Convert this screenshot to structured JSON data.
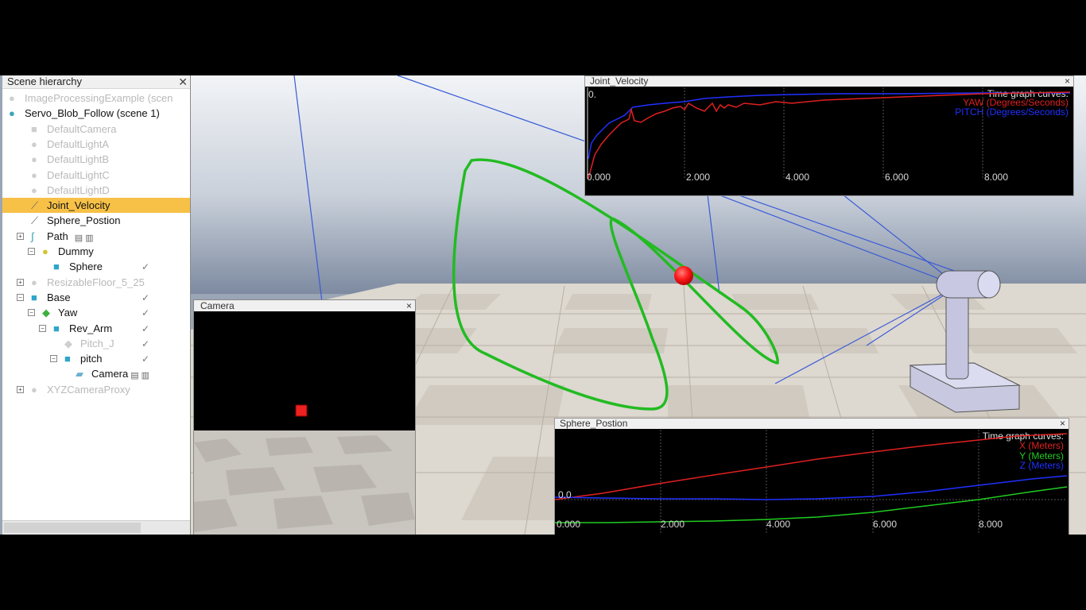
{
  "hierarchy": {
    "title": "Scene hierarchy",
    "close": "✕",
    "items": [
      {
        "label": "ImageProcessingExample (scen",
        "icon": "scene-sphere-icon",
        "dim": true
      },
      {
        "label": "Servo_Blob_Follow (scene 1)",
        "icon": "scene-sphere-icon",
        "dim": false
      },
      {
        "label": "DefaultCamera",
        "icon": "camera-icon",
        "dim": true
      },
      {
        "label": "DefaultLightA",
        "icon": "light-bulb-icon",
        "dim": true
      },
      {
        "label": "DefaultLightB",
        "icon": "light-bulb-icon",
        "dim": true
      },
      {
        "label": "DefaultLightC",
        "icon": "light-bulb-icon",
        "dim": true
      },
      {
        "label": "DefaultLightD",
        "icon": "light-bulb-icon",
        "dim": true
      },
      {
        "label": "Joint_Velocity",
        "icon": "graph-icon",
        "dim": false,
        "selected": true
      },
      {
        "label": "Sphere_Postion",
        "icon": "graph-icon",
        "dim": false
      },
      {
        "label": "Path",
        "icon": "path-icon",
        "dim": false
      },
      {
        "label": "Dummy",
        "icon": "dummy-icon",
        "dim": false
      },
      {
        "label": "Sphere",
        "icon": "shape-cube-icon",
        "dim": false
      },
      {
        "label": "ResizableFloor_5_25",
        "icon": "dummy-icon",
        "dim": true
      },
      {
        "label": "Base",
        "icon": "shape-cube-icon",
        "dim": false
      },
      {
        "label": "Yaw",
        "icon": "joint-icon",
        "dim": false
      },
      {
        "label": "Rev_Arm",
        "icon": "shape-cube-icon",
        "dim": false
      },
      {
        "label": "Pitch_J",
        "icon": "joint-icon",
        "dim": true
      },
      {
        "label": "pitch",
        "icon": "shape-cube-icon",
        "dim": false
      },
      {
        "label": "Camera",
        "icon": "vision-sensor-icon",
        "dim": false
      },
      {
        "label": "XYZCameraProxy",
        "icon": "dummy-icon",
        "dim": true
      }
    ]
  },
  "joint_velocity": {
    "title": "Joint_Velocity",
    "close": "×",
    "legend_title": "Time graph curves:",
    "legend": [
      "YAW (Degrees/Seconds)",
      "PITCH (Degrees/Seconds)"
    ],
    "x_ticks": [
      "0.000",
      "2.000",
      "4.000",
      "6.000",
      "8.000"
    ],
    "y_top_label": "0."
  },
  "sphere_position": {
    "title": "Sphere_Postion",
    "close": "×",
    "legend_title": "Time graph curves:",
    "legend": [
      "X (Meters)",
      "Y (Meters)",
      "Z (Meters)"
    ],
    "x_ticks": [
      "0.000",
      "2.000",
      "4.000",
      "6.000",
      "8.000"
    ],
    "y_label": "0.0"
  },
  "camera_view": {
    "title": "Camera",
    "close": "×"
  },
  "colors": {
    "selection": "#f7c148",
    "path": "#22bb22",
    "sphere": "#ff1a1a",
    "series_red": "#e02020",
    "series_blue": "#2030ff",
    "series_green": "#20cc20"
  }
}
